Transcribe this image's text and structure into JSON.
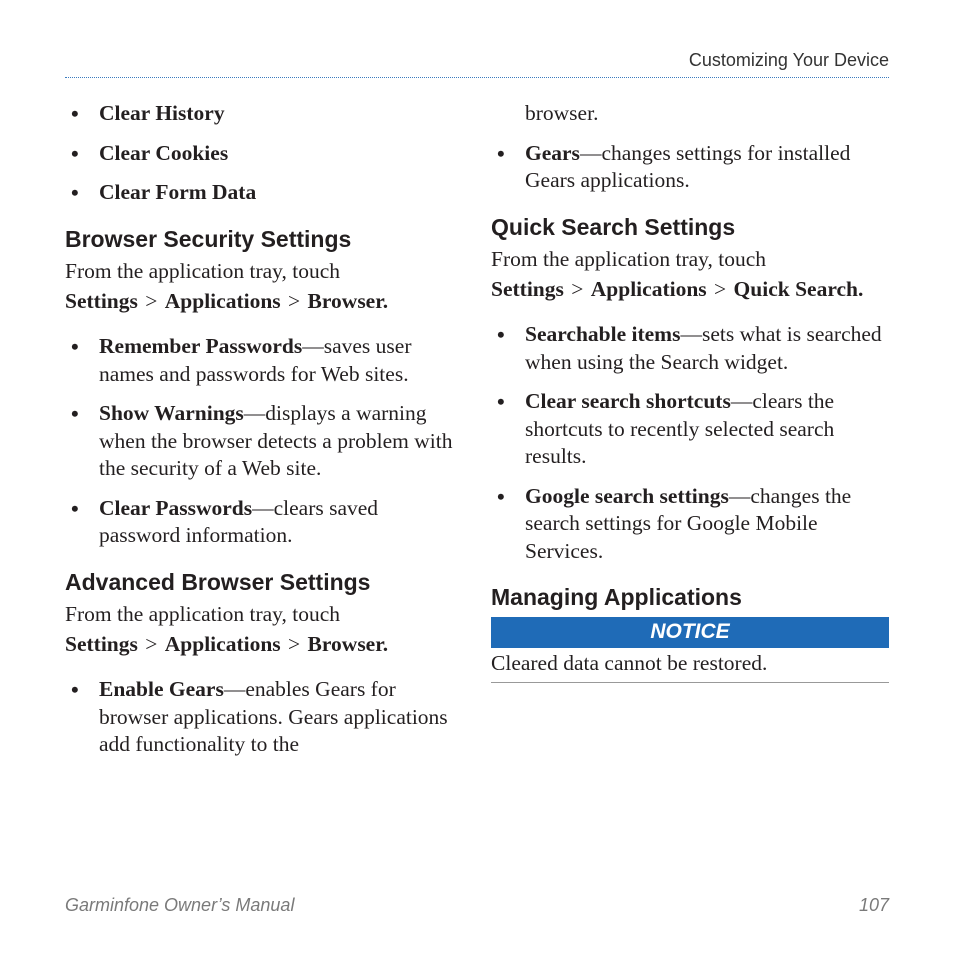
{
  "runningHead": "Customizing Your Device",
  "leftColumn": {
    "topList": [
      "Clear History",
      "Clear Cookies",
      "Clear Form Data"
    ],
    "section1": {
      "heading": "Browser Security Settings",
      "intro": "From the application tray, touch ",
      "path": [
        "Settings",
        "Applications",
        "Browser"
      ],
      "items": [
        {
          "term": "Remember Passwords",
          "desc": "—saves user names and passwords for Web sites."
        },
        {
          "term": "Show Warnings",
          "desc": "—displays a warning when the browser detects a problem with the security of a Web site."
        },
        {
          "term": "Clear Passwords",
          "desc": "—clears saved password information."
        }
      ]
    },
    "section2": {
      "heading": "Advanced Browser Settings",
      "intro": "From the application tray, touch ",
      "path": [
        "Settings",
        "Applications",
        "Browser"
      ],
      "items": [
        {
          "term": "Enable Gears",
          "desc": "—enables Gears for browser applications. Gears applications add functionality to the "
        }
      ]
    }
  },
  "rightColumn": {
    "continuation": "browser.",
    "continuedItems": [
      {
        "term": "Gears",
        "desc": "—changes settings for installed Gears applications."
      }
    ],
    "section3": {
      "heading": "Quick Search Settings",
      "intro": "From the application tray, touch ",
      "path": [
        "Settings",
        "Applications",
        "Quick Search"
      ],
      "items": [
        {
          "term": "Searchable items",
          "desc": "—sets what is searched when using the Search widget."
        },
        {
          "term": "Clear search shortcuts",
          "desc": "—clears the shortcuts to recently selected search results."
        },
        {
          "term": "Google search settings",
          "desc": "—changes the search settings for Google Mobile Services."
        }
      ]
    },
    "section4": {
      "heading": "Managing Applications",
      "noticeLabel": "NOTICE",
      "noticeBody": "Cleared data cannot be restored."
    }
  },
  "footer": {
    "manual": "Garminfone Owner’s Manual",
    "page": "107"
  }
}
